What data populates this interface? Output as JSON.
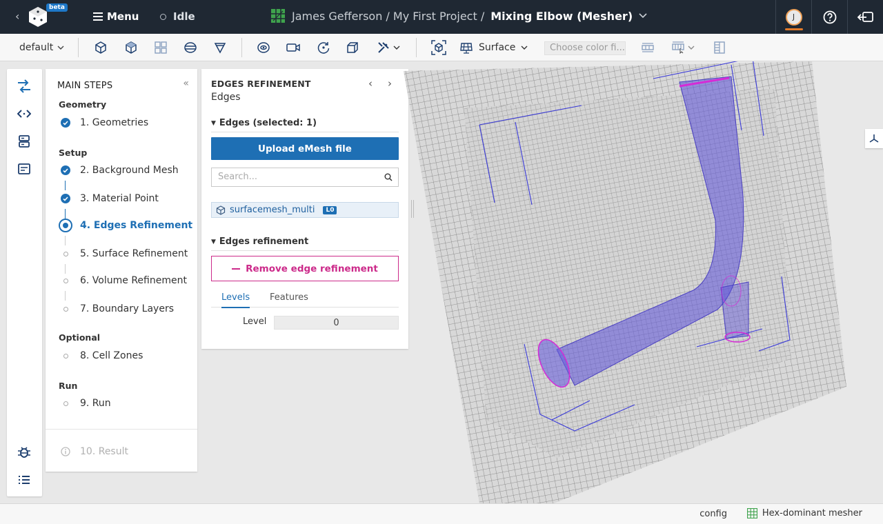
{
  "topbar": {
    "beta": "beta",
    "menu_label": "Menu",
    "status": "Idle",
    "project_path": "James Gefferson / My First Project /",
    "project_name": "Mixing Elbow (Mesher)",
    "user_initial": "J"
  },
  "toolbar": {
    "profile": "default",
    "render_mode": "Surface",
    "color_placeholder": "Choose color fi..."
  },
  "steps": {
    "title": "MAIN STEPS",
    "groups": [
      "Geometry",
      "Setup",
      "Optional",
      "Run"
    ],
    "items": [
      {
        "label": "1. Geometries",
        "state": "done"
      },
      {
        "label": "2. Background Mesh",
        "state": "done"
      },
      {
        "label": "3. Material Point",
        "state": "done"
      },
      {
        "label": "4. Edges Refinement",
        "state": "current"
      },
      {
        "label": "5. Surface Refinement",
        "state": "todo"
      },
      {
        "label": "6. Volume Refinement",
        "state": "todo"
      },
      {
        "label": "7. Boundary Layers",
        "state": "todo"
      },
      {
        "label": "8. Cell Zones",
        "state": "todo"
      },
      {
        "label": "9. Run",
        "state": "todo"
      },
      {
        "label": "10. Result",
        "state": "disabled"
      }
    ]
  },
  "panel": {
    "title": "EDGES REFINEMENT",
    "subtitle": "Edges",
    "edges_section": "Edges (selected: 1)",
    "upload_label": "Upload eMesh file",
    "search_placeholder": "Search...",
    "selected_item": "surfacemesh_multi",
    "selected_badge": "L0",
    "refinement_section": "Edges refinement",
    "remove_label": "Remove edge refinement",
    "tabs": [
      "Levels",
      "Features"
    ],
    "level_label": "Level",
    "level_value": "0"
  },
  "statusbar": {
    "config": "config",
    "mesher": "Hex-dominant mesher"
  },
  "colors": {
    "accent": "#1e6fb4",
    "danger": "#cc2a8a",
    "topbar": "#1f2833",
    "pipe": "#6a5fd8"
  }
}
